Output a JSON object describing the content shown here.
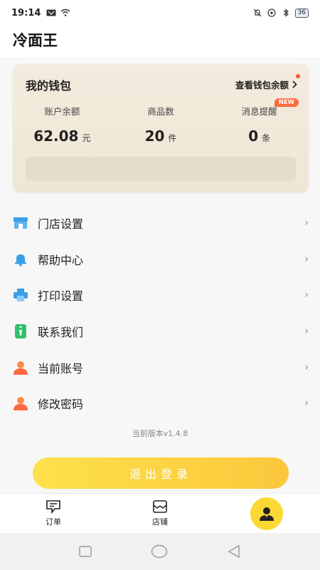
{
  "status_bar": {
    "time": "19:14",
    "battery": "36"
  },
  "header": {
    "title": "冷面王"
  },
  "wallet": {
    "title": "我的钱包",
    "view_balance_link": "查看钱包余额",
    "stats": [
      {
        "label": "账户余额",
        "value": "62.08",
        "unit": "元"
      },
      {
        "label": "商品数",
        "value": "20",
        "unit": "件"
      },
      {
        "label": "消息提醒",
        "value": "0",
        "unit": "条",
        "badge": "NEW"
      }
    ]
  },
  "menu": {
    "items": [
      {
        "label": "门店设置",
        "icon": "store-icon"
      },
      {
        "label": "帮助中心",
        "icon": "bell-icon"
      },
      {
        "label": "打印设置",
        "icon": "printer-icon"
      },
      {
        "label": "联系我们",
        "icon": "phone-icon"
      },
      {
        "label": "当前账号",
        "icon": "user-icon"
      },
      {
        "label": "修改密码",
        "icon": "user-icon"
      }
    ]
  },
  "version": "当前版本v1.4.8",
  "logout_label": "退出登录",
  "tabbar": {
    "tabs": [
      {
        "label": "订单",
        "icon": "order-icon"
      },
      {
        "label": "店铺",
        "icon": "shop-icon"
      },
      {
        "label": "",
        "icon": "profile-icon"
      }
    ]
  },
  "colors": {
    "accent": "#fdd835",
    "wallet_bg": "#f3ebdd",
    "badge": "#ff6a3c"
  }
}
